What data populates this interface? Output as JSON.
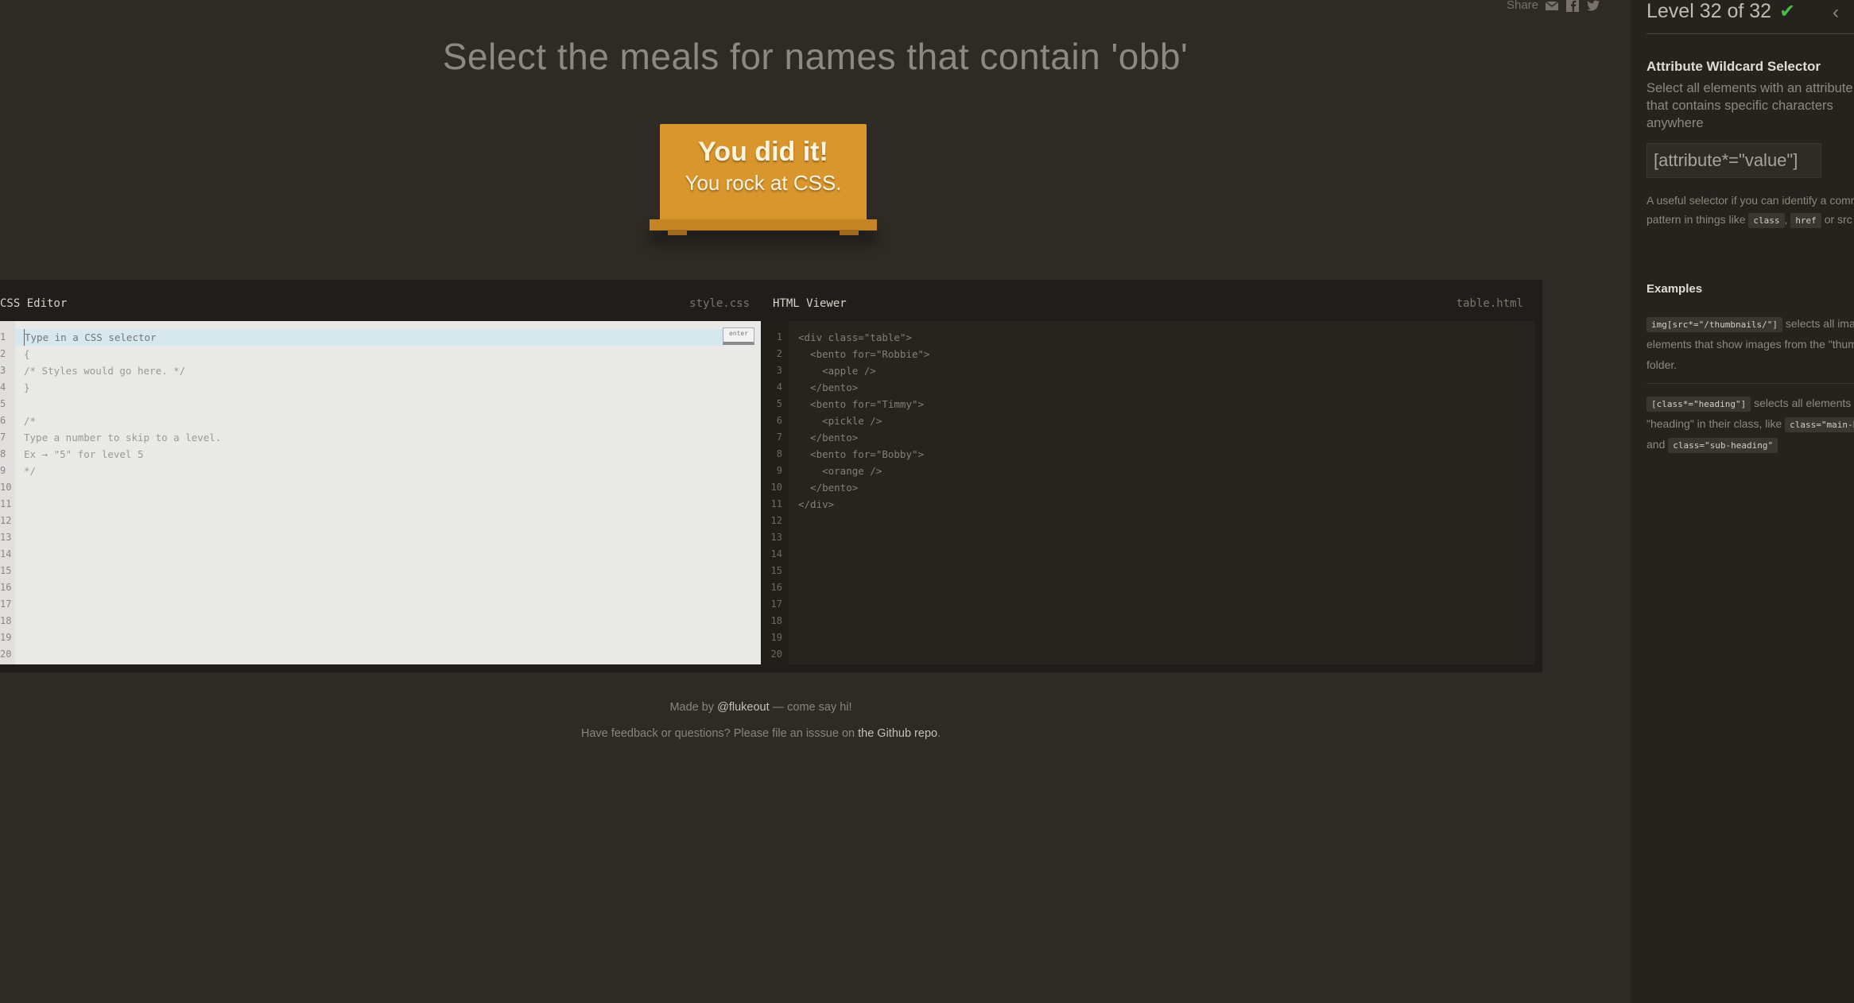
{
  "header": {
    "share_label": "Share",
    "instruction": "Select the meals for names that contain 'obb'"
  },
  "table": {
    "line1": "You did it!",
    "line2": "You rock at CSS."
  },
  "css_editor": {
    "title": "CSS Editor",
    "filename": "style.css",
    "placeholder": "Type in a CSS selector",
    "enter_label": "enter",
    "line_numbers": [
      "1",
      "2",
      "3",
      "4",
      "5",
      "6",
      "7",
      "8",
      "9",
      "10",
      "11",
      "12",
      "13",
      "14",
      "15",
      "16",
      "17",
      "18",
      "19",
      "20"
    ],
    "code": "\n{\n/* Styles would go here. */\n}\n\n/*\nType a number to skip to a level.\nEx → \"5\" for level 5\n*/"
  },
  "html_viewer": {
    "title": "HTML Viewer",
    "filename": "table.html",
    "line_numbers": [
      "1",
      "2",
      "3",
      "4",
      "5",
      "6",
      "7",
      "8",
      "9",
      "10",
      "11",
      "12",
      "13",
      "14",
      "15",
      "16",
      "17",
      "18",
      "19",
      "20"
    ],
    "code": "<div class=\"table\">\n  <bento for=\"Robbie\">\n    <apple />\n  </bento>\n  <bento for=\"Timmy\">\n    <pickle />\n  </bento>\n  <bento for=\"Bobby\">\n    <orange />\n  </bento>\n</div>"
  },
  "footer": {
    "made_by_prefix": "Made by ",
    "made_by_link": "@flukeout",
    "made_by_suffix": " — come say hi!",
    "feedback_prefix": "Have feedback or questions? Please file an isssue on ",
    "feedback_link": "the Github repo",
    "feedback_suffix": "."
  },
  "sidebar": {
    "level_text": "Level 32 of 32",
    "selector_name": "Attribute Wildcard Selector",
    "description": "Select all elements with an attribute value that contains specific characters anywhere",
    "syntax": "[attribute*=\"value\"]",
    "hint_prefix": "A useful selector if you can identify a common pattern in things like ",
    "hint_chip1": "class",
    "hint_sep": ",",
    "hint_chip2": "href",
    "hint_suffix": " or src attributes.",
    "examples_title": "Examples",
    "example1_code": "img[src*=\"/thumbnails/\"]",
    "example1_text": " selects all image elements that show images from the \"thumbnails\" folder.",
    "example2_code": "[class*=\"heading\"]",
    "example2_text": " selects all elements with \"heading\" in their class, like ",
    "example2_chip2": "class=\"main-heading\"",
    "example2_and": " and ",
    "example2_chip3": "class=\"sub-heading\""
  },
  "colors": {
    "background": "#2e2a25",
    "sidebar": "#26231f",
    "table": "#d9962c",
    "check": "#4cbb4a"
  },
  "icons": [
    "mail-icon",
    "facebook-icon",
    "twitter-icon",
    "check-icon",
    "chevron-left-icon"
  ]
}
